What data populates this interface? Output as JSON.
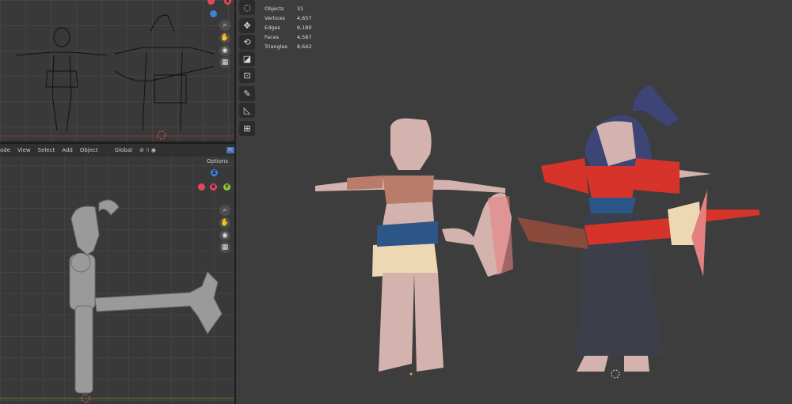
{
  "header": {
    "mode": "ode",
    "menus": [
      "View",
      "Select",
      "Add",
      "Object"
    ],
    "orientation": "Global",
    "options": "Options"
  },
  "stats": [
    {
      "label": "Objects",
      "value": "31"
    },
    {
      "label": "Vertices",
      "value": "4,657"
    },
    {
      "label": "Edges",
      "value": "9,180"
    },
    {
      "label": "Faces",
      "value": "4,587"
    },
    {
      "label": "Triangles",
      "value": "8,642"
    }
  ],
  "gizmo": {
    "x": "X",
    "y": "Y",
    "z": "Z"
  },
  "nav_icons": [
    "zoom-icon",
    "hand-pan-icon",
    "camera-icon",
    "grid-icon"
  ],
  "tools": [
    "cursor-icon",
    "move-icon",
    "rotate-icon",
    "scale-icon",
    "transform-icon",
    "annotate-icon",
    "measure-icon",
    "add-cube-icon"
  ],
  "colors": {
    "skin": "#d4b3ae",
    "red": "#d6332b",
    "dark": "#3c3f4a",
    "hair": "#3d4476",
    "belt": "#2d5688",
    "cream": "#eed8b4",
    "brown": "#8a4a3c"
  }
}
